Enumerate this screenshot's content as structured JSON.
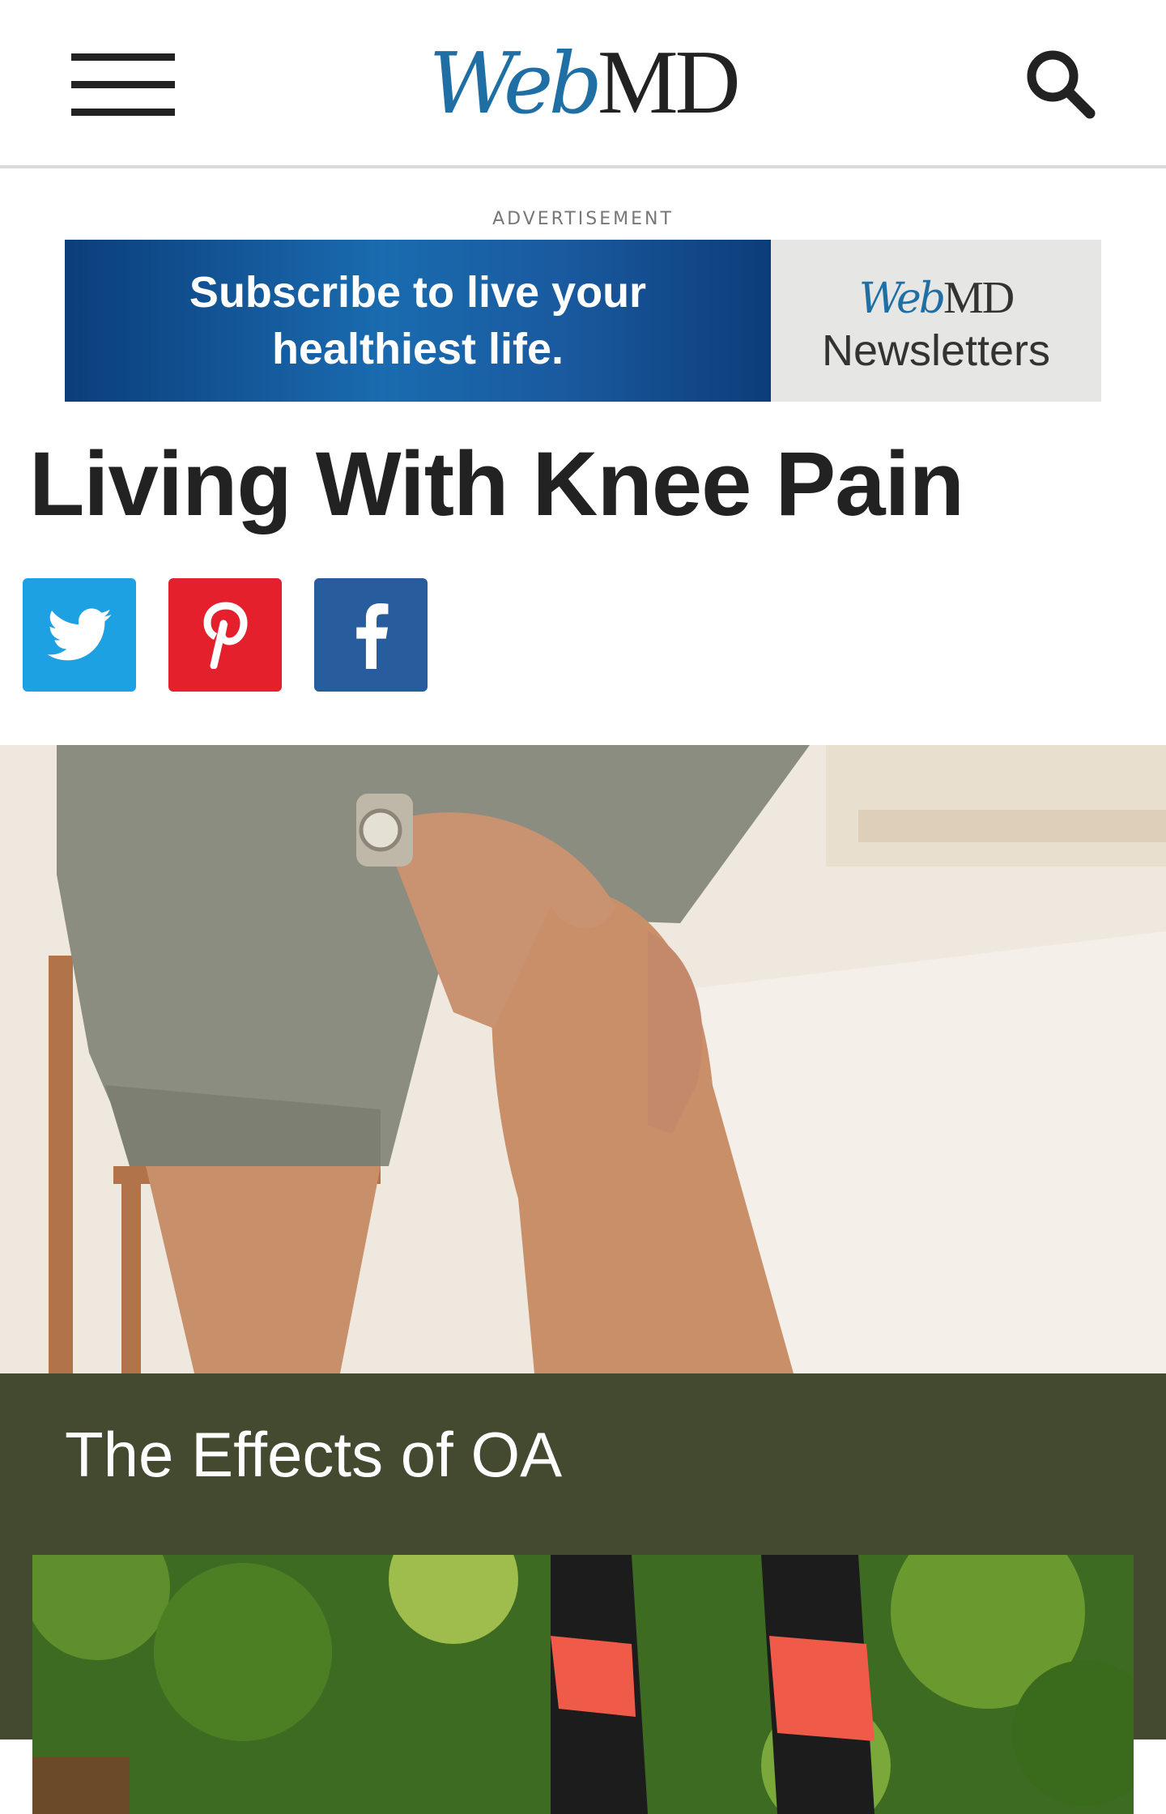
{
  "header": {
    "logo_web": "Web",
    "logo_md": "MD",
    "menu_icon": "hamburger-menu-icon",
    "search_icon": "search-icon"
  },
  "ad": {
    "label": "ADVERTISEMENT",
    "headline": "Subscribe to live your healthiest life.",
    "brand_web": "Web",
    "brand_md": "MD",
    "brand_sub": "Newsletters"
  },
  "article": {
    "title": "Living With Knee Pain"
  },
  "share": {
    "twitter_icon": "twitter-icon",
    "pinterest_icon": "pinterest-icon",
    "facebook_icon": "facebook-icon",
    "twitter_color": "#1da1e2",
    "pinterest_color": "#e3202b",
    "facebook_color": "#275c9d"
  },
  "slide": {
    "caption": "The Effects of OA",
    "caption_bar_color": "#434a30"
  }
}
